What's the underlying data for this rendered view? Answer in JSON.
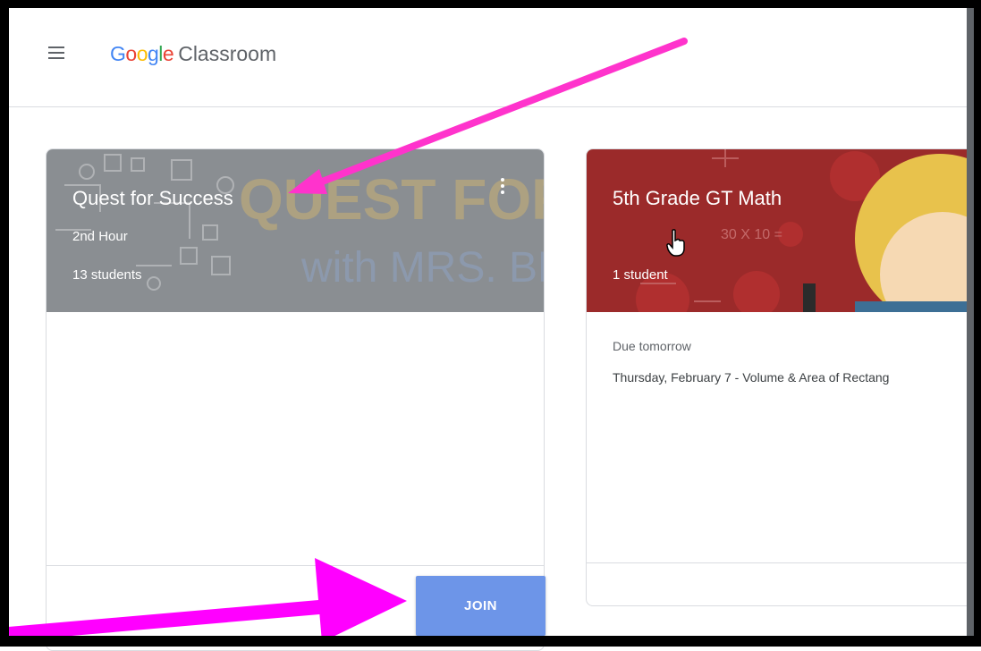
{
  "app": {
    "brand": {
      "G": "G",
      "o1": "o",
      "o2": "o",
      "g": "g",
      "l": "l",
      "e": "e"
    },
    "product": "Classroom"
  },
  "classes": [
    {
      "title": "Quest for Success",
      "section": "2nd Hour",
      "students": "13 students",
      "banner_text_1": "QUEST FOR SU",
      "banner_text_2": "with MRS. BRA"
    },
    {
      "title": "5th Grade GT Math",
      "students": "1 student",
      "due_label": "Due tomorrow",
      "due_item": "Thursday, February 7 - Volume & Area of Rectang"
    }
  ],
  "join_button": {
    "label": "JOIN"
  },
  "colors": {
    "annotation_arrow": "#ff33cc",
    "join_button": "#6d95e8",
    "card2_banner": "#9b2a2a",
    "card1_banner": "#8a8e92"
  },
  "icons": {
    "menu": "menu-icon",
    "more": "more-vert-icon",
    "cursor": "hand-pointer-icon"
  }
}
